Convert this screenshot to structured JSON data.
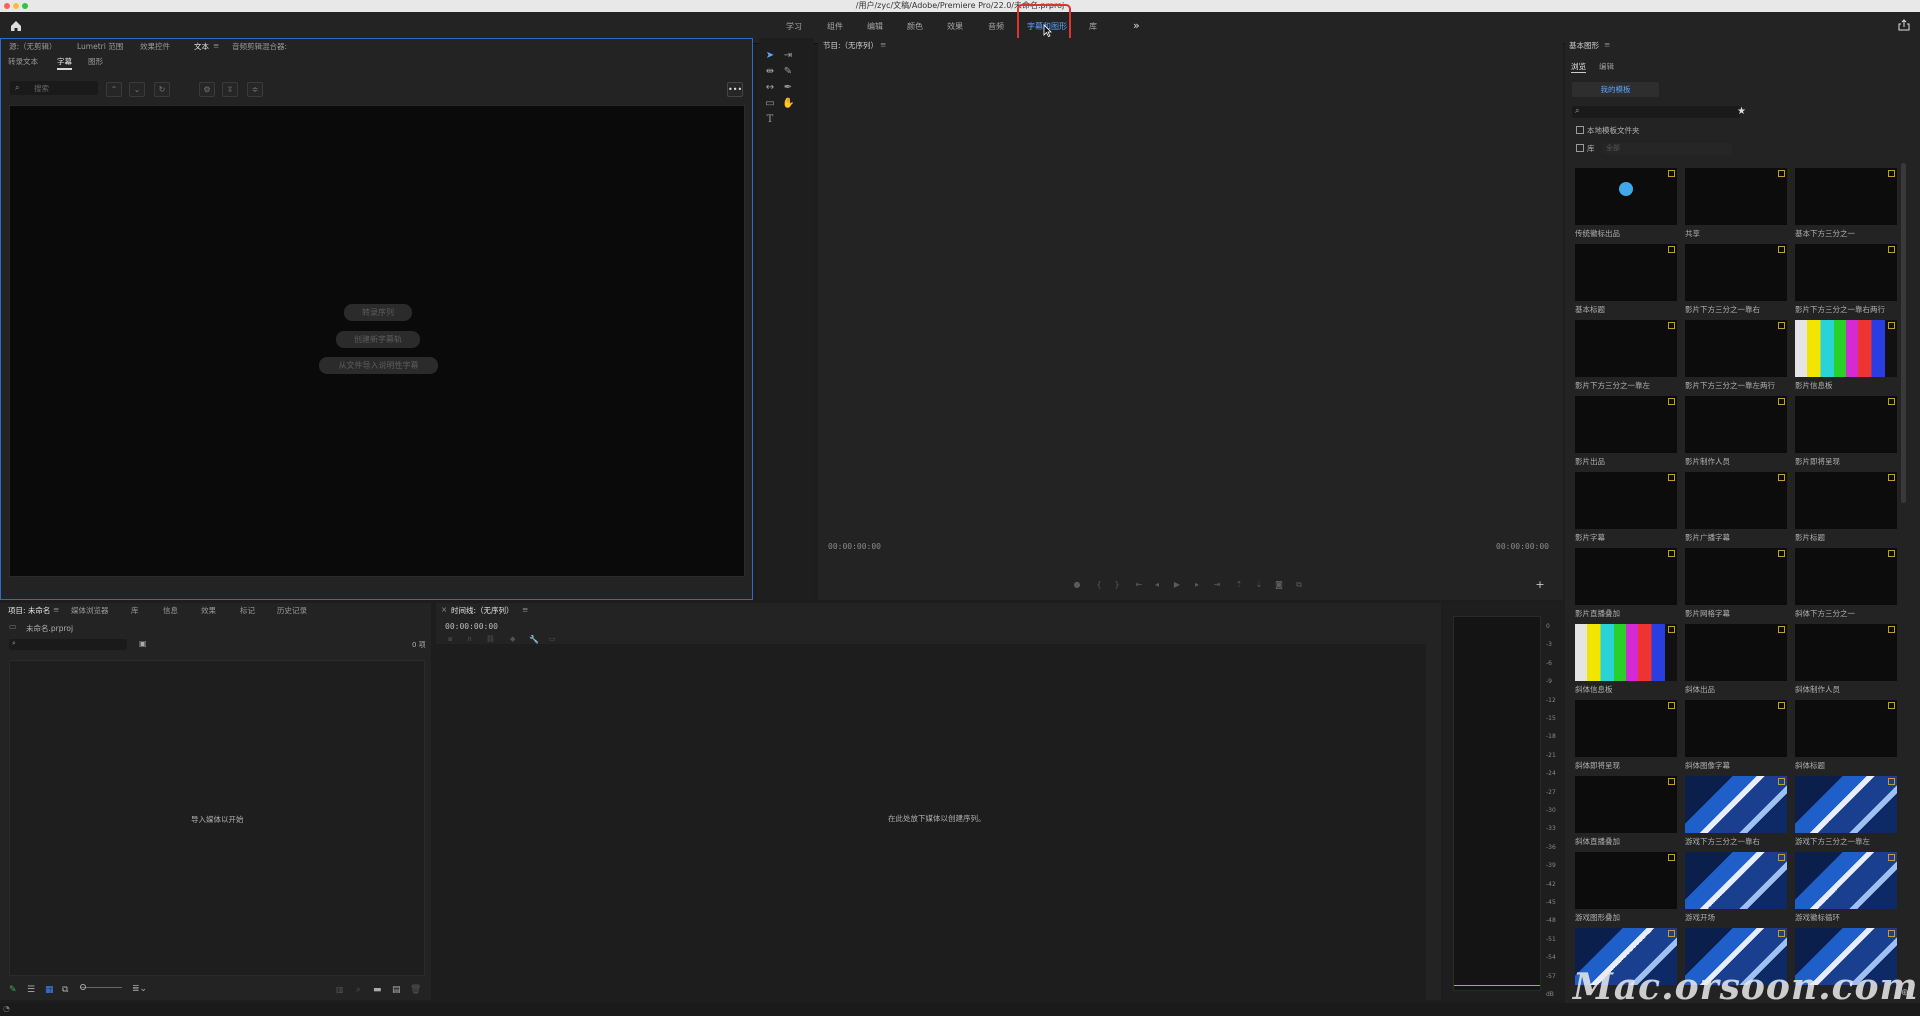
{
  "window": {
    "title": "/用户/zyc/文稿/Adobe/Premiere Pro/22.0/未命名.prproj"
  },
  "workspaces": {
    "items": [
      "学习",
      "组件",
      "编辑",
      "颜色",
      "效果",
      "音频",
      "字幕和图形",
      "库"
    ],
    "active": "字幕和图形",
    "more": "»"
  },
  "source_panel": {
    "tabs": [
      "源:（无剪辑）",
      "Lumetri 范围",
      "效果控件",
      "文本",
      "音频剪辑混合器:"
    ],
    "subtabs": [
      "转录文本",
      "字幕",
      "图形"
    ],
    "search_placeholder": "搜索",
    "buttons": [
      "转录序列",
      "创建新字幕轨",
      "从文件导入说明性字幕"
    ]
  },
  "program_monitor": {
    "title": "节目:（无序列）",
    "timecode_left": "00:00:00:00",
    "timecode_right": "00:00:00:00"
  },
  "essential_graphics": {
    "title": "基本图形",
    "tabs": [
      "浏览",
      "编辑"
    ],
    "my_templates": "我的模板",
    "local_folder": "本地模板文件夹",
    "library_label": "库",
    "library_select": "全部",
    "templates": [
      "传统徽标出品",
      "共享",
      "基本下方三分之一",
      "基本标题",
      "影片下方三分之一靠右",
      "影片下方三分之一靠右两行",
      "影片下方三分之一靠左",
      "影片下方三分之一靠左两行",
      "影片信息板",
      "影片出品",
      "影片制作人员",
      "影片即将呈现",
      "影片字幕",
      "影片广播字幕",
      "影片标题",
      "影片直播叠加",
      "影片网格字幕",
      "斜体下方三分之一",
      "斜体信息板",
      "斜体出品",
      "斜体制作人员",
      "斜体即将呈现",
      "斜体图像字幕",
      "斜体标题",
      "斜体直播叠加",
      "游戏下方三分之一靠右",
      "游戏下方三分之一靠左",
      "游戏图形叠加",
      "游戏开场",
      "游戏徽标循环",
      "",
      "",
      ""
    ]
  },
  "project_panel": {
    "tabs": [
      "项目: 未命名",
      "媒体浏览器",
      "库",
      "信息",
      "效果",
      "标记",
      "历史记录"
    ],
    "file": "未命名.prproj",
    "count": "0 项",
    "empty_hint": "导入媒体以开始"
  },
  "timeline_panel": {
    "title": "时间线:（无序列）",
    "timecode": "00:00:00:00",
    "empty_hint": "在此处放下媒体以创建序列。"
  },
  "audio_meter": {
    "ticks": [
      "0",
      "-3",
      "-6",
      "-9",
      "-12",
      "-15",
      "-18",
      "-21",
      "-24",
      "-27",
      "-30",
      "-33",
      "-36",
      "-39",
      "-42",
      "-45",
      "-48",
      "-51",
      "-54",
      "-57",
      "dB"
    ]
  },
  "watermark": "Mac.orsoon.com",
  "colors": {
    "accent": "#5aa4ff",
    "highlight": "#e0332e",
    "panel": "#232323",
    "focus_border": "#2d6cc7"
  }
}
